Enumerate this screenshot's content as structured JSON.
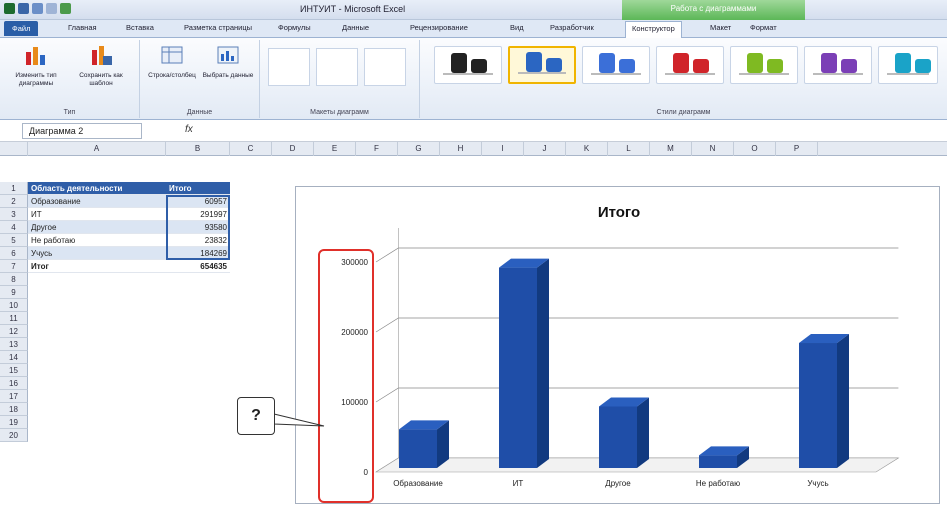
{
  "window": {
    "title": "ИНТУИТ - Microsoft Excel",
    "context_group": "Работа с диаграммами"
  },
  "top_partial_text": [
    "д",
    "д"
  ],
  "tabs": [
    {
      "label": "Файл",
      "active": false
    },
    {
      "label": "Главная",
      "active": false
    },
    {
      "label": "Вставка",
      "active": false
    },
    {
      "label": "Разметка страницы",
      "active": false
    },
    {
      "label": "Формулы",
      "active": false
    },
    {
      "label": "Данные",
      "active": false
    },
    {
      "label": "Рецензирование",
      "active": false
    },
    {
      "label": "Вид",
      "active": false
    },
    {
      "label": "Разработчик",
      "active": false
    },
    {
      "label": "Конструктор",
      "active": true
    },
    {
      "label": "Макет",
      "active": false
    },
    {
      "label": "Формат",
      "active": false
    }
  ],
  "ribbon": {
    "groups": [
      {
        "label": "Тип",
        "buttons": [
          "Изменить тип диаграммы",
          "Сохранить как шаблон"
        ]
      },
      {
        "label": "Данные",
        "buttons": [
          "Строка/столбец",
          "Выбрать данные"
        ]
      },
      {
        "label": "Макеты диаграмм"
      },
      {
        "label": "Стили диаграмм"
      }
    ],
    "style_colors": [
      "#222222",
      "#2b66c2",
      "#3b6fd8",
      "#d0242a",
      "#7fba22",
      "#7b3fb6",
      "#1aa3c8"
    ]
  },
  "formula_bar": {
    "name_box": "Диаграмма 2",
    "fx": "fx"
  },
  "columns": [
    "A",
    "B",
    "C",
    "D",
    "E",
    "F",
    "G",
    "H",
    "I",
    "J",
    "K",
    "L",
    "M",
    "N",
    "O",
    "P"
  ],
  "rows": [
    "1",
    "2",
    "3",
    "4",
    "5",
    "6",
    "7",
    "8",
    "9",
    "10",
    "11",
    "12",
    "13",
    "14",
    "15",
    "16",
    "17",
    "18",
    "19",
    "20"
  ],
  "table": {
    "headers": [
      "Область деятельности",
      "Итого"
    ],
    "rows": [
      {
        "label": "Образование",
        "value": "60957"
      },
      {
        "label": "ИТ",
        "value": "291997"
      },
      {
        "label": "Другое",
        "value": "93580"
      },
      {
        "label": "Не работаю",
        "value": "23832"
      },
      {
        "label": "Учусь",
        "value": "184269"
      }
    ],
    "total": {
      "label": "Итог",
      "value": "654635"
    }
  },
  "callout": "?",
  "chart_data": {
    "type": "bar",
    "title": "Итого",
    "categories": [
      "Образование",
      "ИТ",
      "Другое",
      "Не работаю",
      "Учусь"
    ],
    "values": [
      60957,
      291997,
      93580,
      23832,
      184269
    ],
    "ytick_labels": [
      "0",
      "100000",
      "200000",
      "300000"
    ],
    "yticks": [
      0,
      100000,
      200000,
      300000
    ],
    "ylim": [
      0,
      300000
    ],
    "grid": true,
    "bar_color": "#1f4ea8"
  }
}
